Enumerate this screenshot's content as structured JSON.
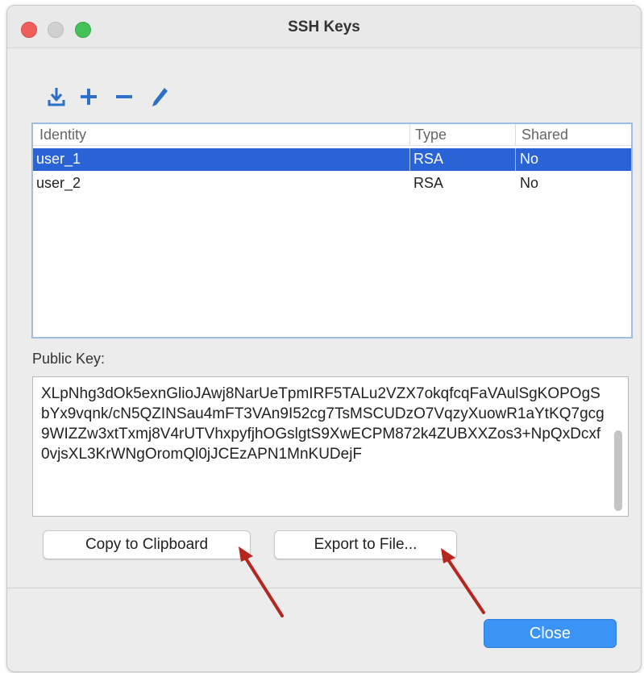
{
  "window": {
    "title": "SSH Keys"
  },
  "toolbar": {
    "icons": [
      "import-icon",
      "add-icon",
      "remove-icon",
      "edit-icon"
    ]
  },
  "table": {
    "columns": [
      "Identity",
      "Type",
      "Shared"
    ],
    "rows": [
      {
        "identity": "user_1",
        "type": "RSA",
        "shared": "No",
        "selected": true
      },
      {
        "identity": "user_2",
        "type": "RSA",
        "shared": "No",
        "selected": false
      }
    ]
  },
  "public_key": {
    "label": "Public Key:",
    "value": "XLpNhg3dOk5exnGlioJAwj8NarUeTpmIRF5TALu2VZX7okqfcqFaVAulSgKOPOgSbYx9vqnk/cN5QZINSau4mFT3VAn9I52cg7TsMSCUDzO7VqzyXuowR1aYtKQ7gcg9WIZZw3xtTxmj8V4rUTVhxpyfjhOGslgtS9XwECPM872k4ZUBXXZos3+NpQxDcxf0vjsXL3KrWNgOromQl0jJCEzAPN1MnKUDejF"
  },
  "buttons": {
    "copy": "Copy to Clipboard",
    "export": "Export to File...",
    "close": "Close"
  },
  "colors": {
    "selection": "#2a63d6",
    "accent": "#3b93f6",
    "toolbar_icon": "#2b6fc9",
    "annotation_arrow": "#b5261e"
  }
}
